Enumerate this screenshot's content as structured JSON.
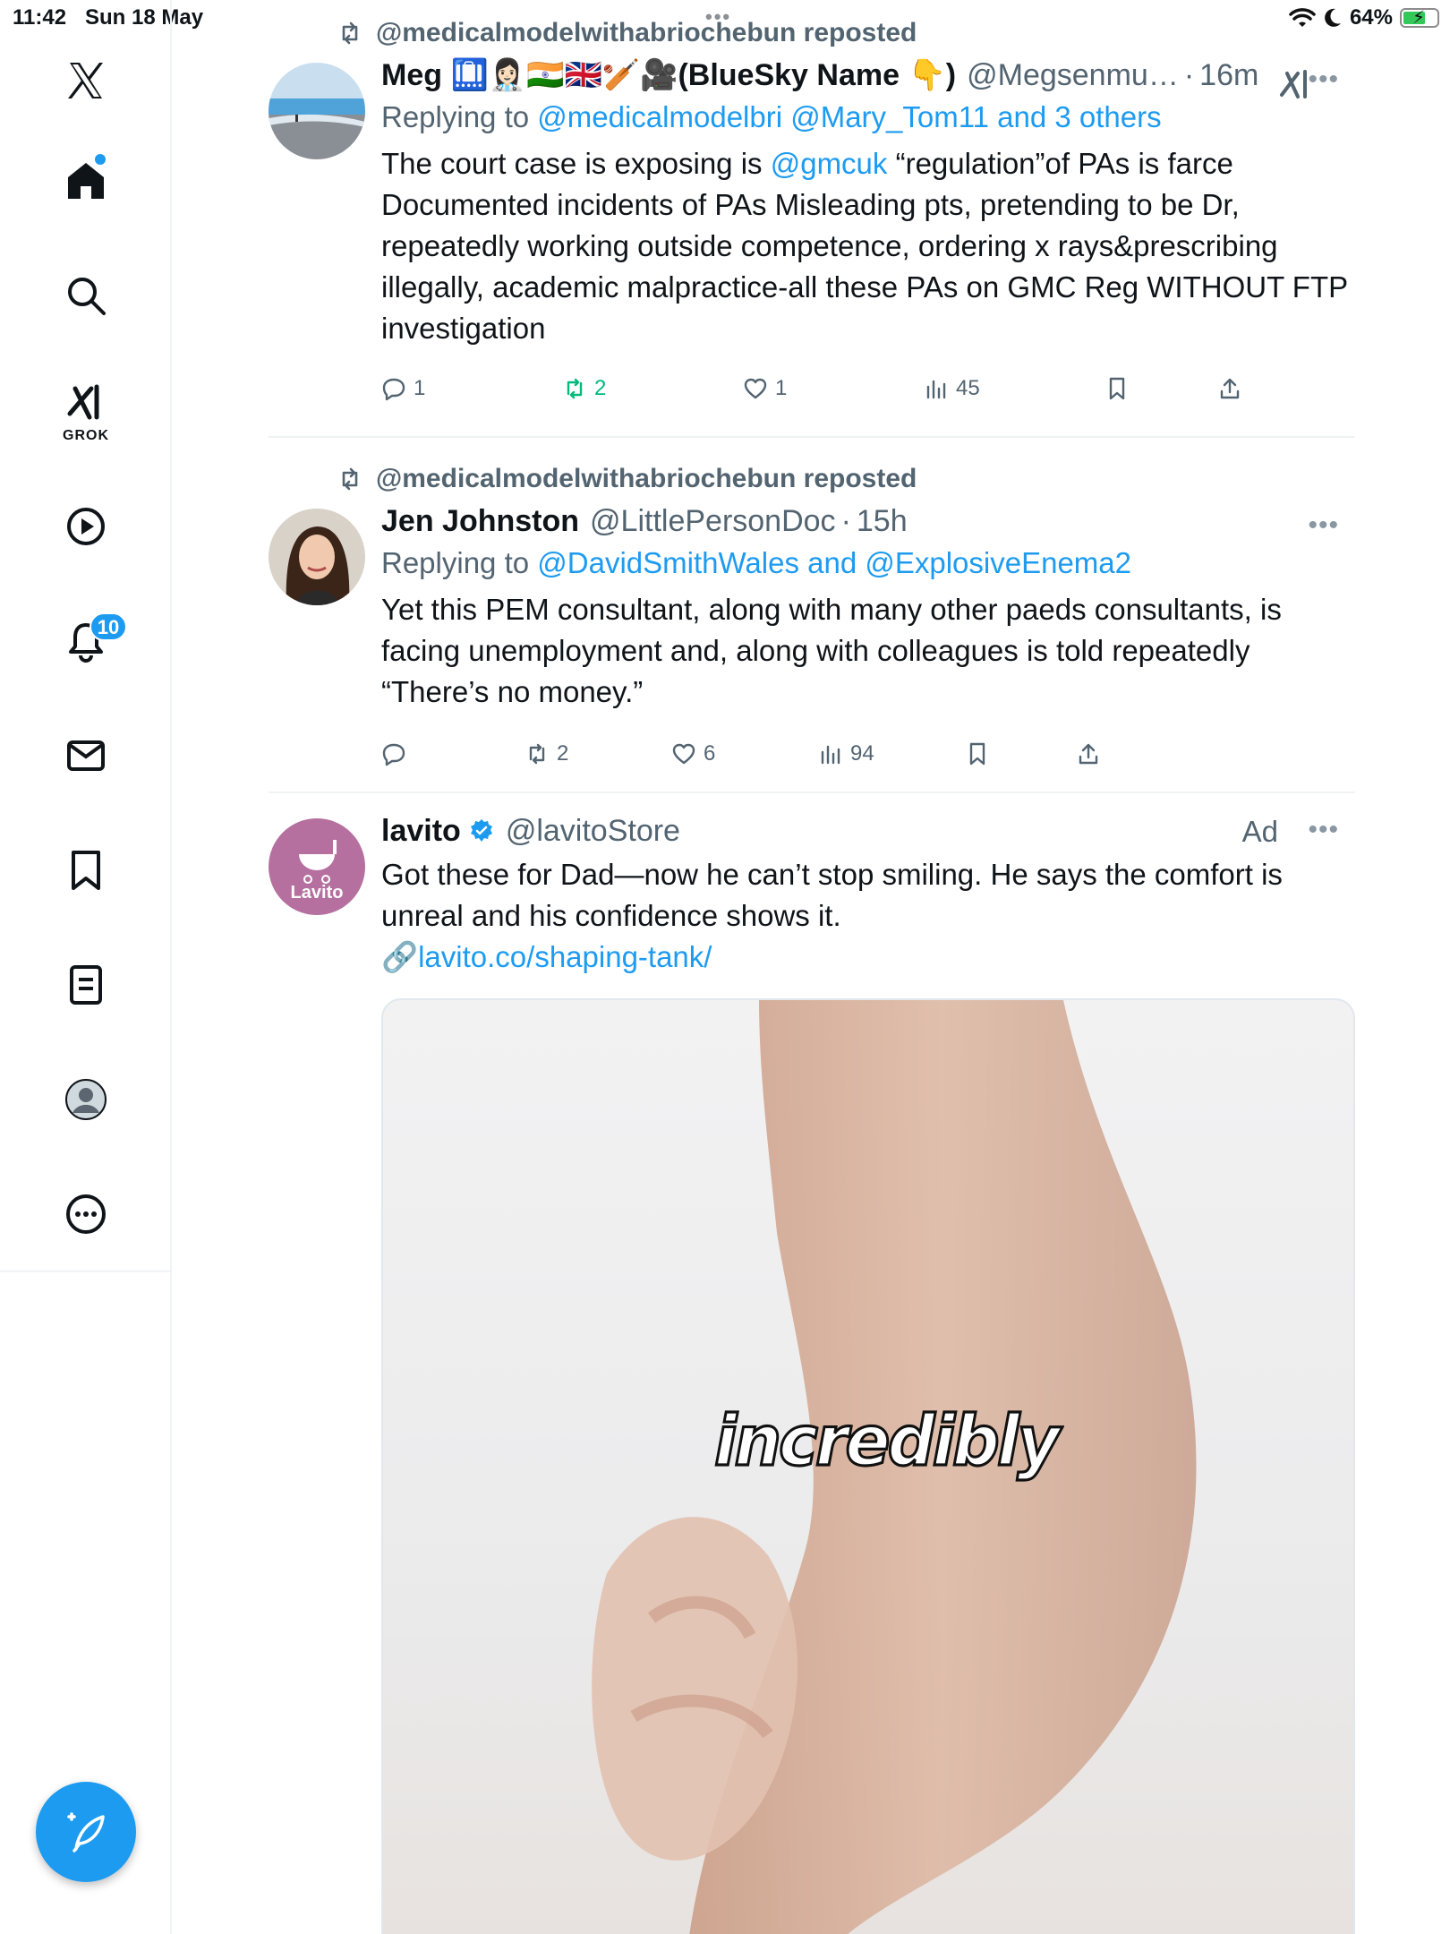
{
  "status_bar": {
    "time": "11:42",
    "date": "Sun 18 May",
    "battery": "64%"
  },
  "sidebar": {
    "grok_label": "GROK",
    "notifications_badge": "10"
  },
  "tweets": [
    {
      "repost_by": "@medicalmodelwithabriochebun reposted",
      "name": "Meg 🛄👩🏻‍⚕️🇮🇳🇬🇧🏏🎥(BlueSky Name 👇)",
      "handle": "@Megsenmu…",
      "time": "16m",
      "reply_prefix": "Replying to",
      "reply_to": "@medicalmodelbri @Mary_Tom11 and 3 others",
      "text_prefix": "The court case is exposing is",
      "text_mention": "@gmcuk",
      "text_rest": "“regulation”of PAs is farce Documented incidents of PAs Misleading pts, pretending to be Dr, repeatedly working outside competence, ordering x rays&prescribing illegally, academic malpractice-all these PAs on GMC Reg WITHOUT FTP investigation",
      "replies": "1",
      "reposts": "2",
      "likes": "1",
      "views": "45"
    },
    {
      "repost_by": "@medicalmodelwithabriochebun reposted",
      "name": "Jen Johnston",
      "handle": "@LittlePersonDoc",
      "time": "15h",
      "reply_prefix": "Replying to",
      "reply_to": "@DavidSmithWales and @ExplosiveEnema2",
      "text": "Yet this PEM consultant, along with many other paeds consultants, is facing unemployment and, along with colleagues is told repeatedly “There’s no money.”",
      "replies": "",
      "reposts": "2",
      "likes": "6",
      "views": "94"
    },
    {
      "name": "lavito",
      "handle": "@lavitoStore",
      "ad_label": "Ad",
      "avatar_text": "Lavito",
      "text": "Got these for Dad—now he can’t stop smiling. He says the comfort is unreal and his confidence shows it.",
      "link_icon": "🔗",
      "link": "lavito.co/shaping-tank/",
      "media_caption": "incredibly"
    }
  ],
  "colors": {
    "accent": "#1d9bf0",
    "repost_green": "#00ba7c",
    "secondary_text": "#536471"
  }
}
